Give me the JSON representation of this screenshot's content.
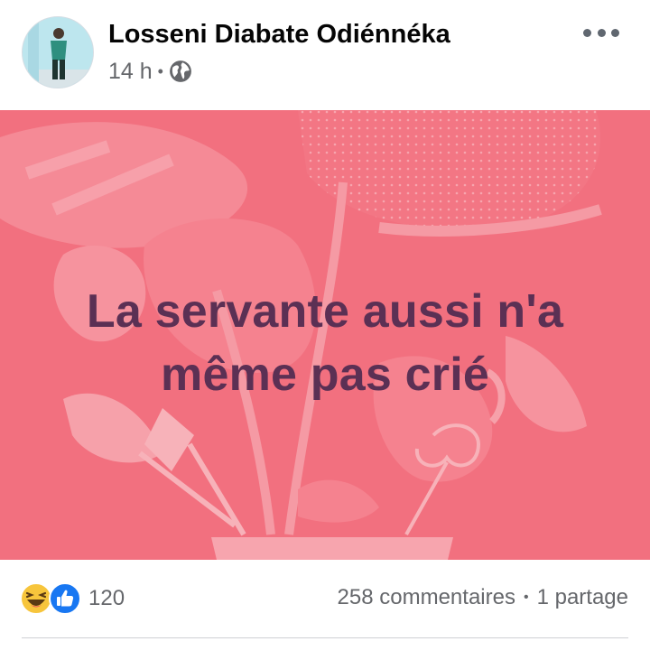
{
  "post": {
    "author": "Losseni Diabate Odiénnéka",
    "time": "14 h",
    "separator": "•",
    "privacy_icon": "globe-icon",
    "menu_icon": "more-dots-icon",
    "text_line1": "La servante aussi n'a",
    "text_line2": "même pas crié",
    "background_color": "#f2707f",
    "text_color": "#5b3054"
  },
  "engagement": {
    "reaction_icons": [
      "haha-icon",
      "like-icon"
    ],
    "reaction_count": "120",
    "comments": "258 commentaires",
    "separator": "•",
    "shares": "1 partage"
  }
}
